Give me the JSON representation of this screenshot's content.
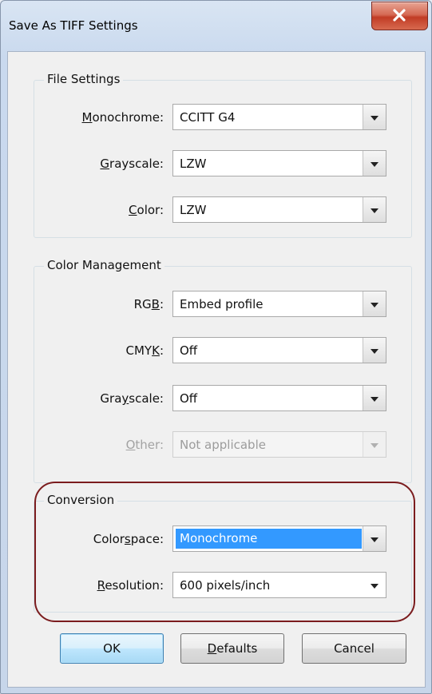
{
  "window": {
    "title": "Save As TIFF Settings"
  },
  "file_settings": {
    "legend": "File Settings",
    "monochrome": {
      "label_pre": "",
      "label_key": "M",
      "label_post": "onochrome:",
      "value": "CCITT G4"
    },
    "grayscale": {
      "label_pre": "",
      "label_key": "G",
      "label_post": "rayscale:",
      "value": "LZW"
    },
    "color": {
      "label_pre": "",
      "label_key": "C",
      "label_post": "olor:",
      "value": "LZW"
    }
  },
  "color_management": {
    "legend": "Color Management",
    "rgb": {
      "label_pre": "RG",
      "label_key": "B",
      "label_post": ":",
      "value": "Embed profile"
    },
    "cmyk": {
      "label_pre": "CMY",
      "label_key": "K",
      "label_post": ":",
      "value": "Off"
    },
    "grayscale": {
      "label_pre": "Gra",
      "label_key": "y",
      "label_post": "scale:",
      "value": "Off"
    },
    "other": {
      "label_pre": "",
      "label_key": "O",
      "label_post": "ther:",
      "value": "Not applicable"
    }
  },
  "conversion": {
    "legend": "Conversion",
    "colorspace": {
      "label_pre": "Color",
      "label_key": "s",
      "label_post": "pace:",
      "value": "Monochrome"
    },
    "resolution": {
      "label_pre": "",
      "label_key": "R",
      "label_post": "esolution:",
      "value": "600 pixels/inch"
    }
  },
  "buttons": {
    "ok": "OK",
    "defaults_key": "D",
    "defaults_rest": "efaults",
    "cancel": "Cancel"
  },
  "colors": {
    "highlight_ring": "#7b1c1e",
    "selection": "#3399ff",
    "close_button": "#c13c25"
  }
}
